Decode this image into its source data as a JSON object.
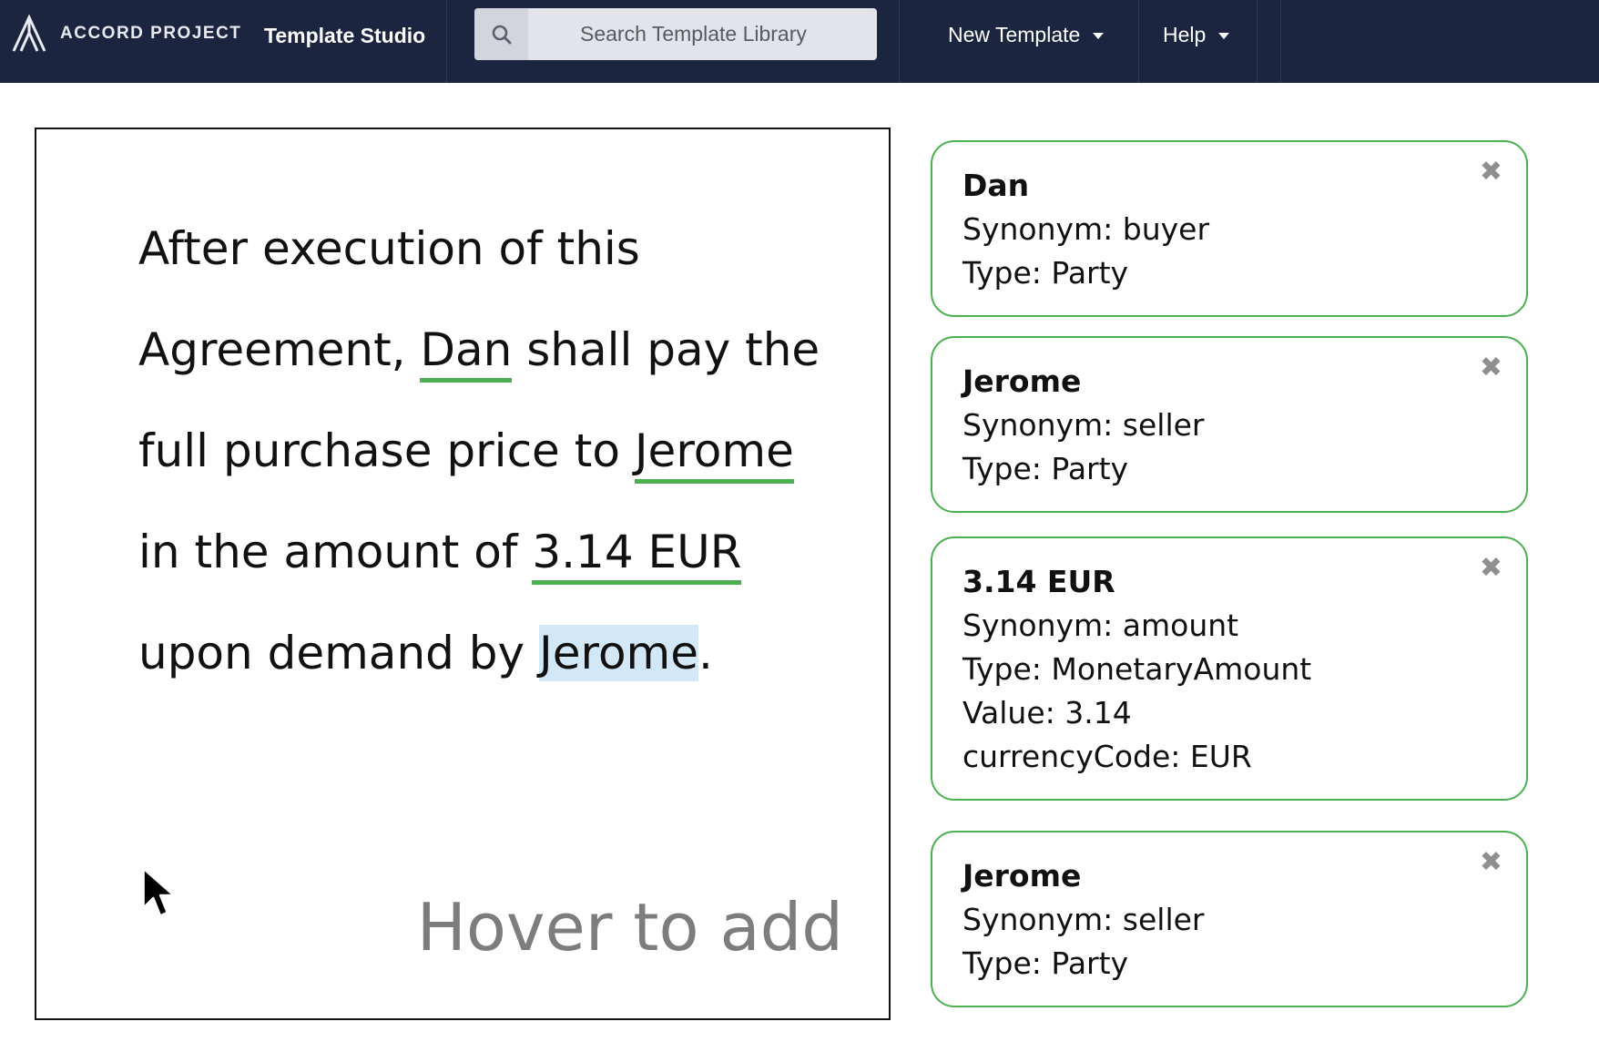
{
  "header": {
    "brand": "ACCORD PROJECT",
    "app_title": "Template Studio",
    "search": {
      "placeholder": "Search Template Library"
    },
    "menus": [
      {
        "label": "New Template"
      },
      {
        "label": "Help"
      }
    ]
  },
  "editor": {
    "clause_segments": [
      {
        "text": "After execution of this Agreement, "
      },
      {
        "text": "Dan",
        "variable": true
      },
      {
        "text": " shall pay the full purchase price to "
      },
      {
        "text": "Jerome",
        "variable": true
      },
      {
        "text": " in the amount of "
      },
      {
        "text": "3.14 EUR",
        "variable": true
      },
      {
        "text": " upon demand by "
      },
      {
        "text": "Jerome",
        "hovered": true
      },
      {
        "text": "."
      }
    ],
    "hover_hint": "Hover to add"
  },
  "cards": [
    {
      "title": "Dan",
      "lines": [
        "Synonym: buyer",
        "Type: Party"
      ]
    },
    {
      "title": "Jerome",
      "lines": [
        "Synonym: seller",
        "Type: Party"
      ]
    },
    {
      "title": "3.14 EUR",
      "lines": [
        "Synonym: amount",
        "Type: MonetaryAmount",
        "Value: 3.14",
        "currencyCode: EUR"
      ]
    },
    {
      "title": "Jerome",
      "lines": [
        "Synonym: seller",
        "Type: Party"
      ]
    }
  ],
  "close_glyph": "✖",
  "colors": {
    "navbar": "#1b2540",
    "variable_underline": "#4caf50",
    "card_border": "#4caf50",
    "hover_highlight": "#d3e8f7"
  },
  "icons": [
    "accord-logo-icon",
    "search-icon",
    "chevron-down-icon",
    "close-icon",
    "mouse-pointer-icon"
  ]
}
